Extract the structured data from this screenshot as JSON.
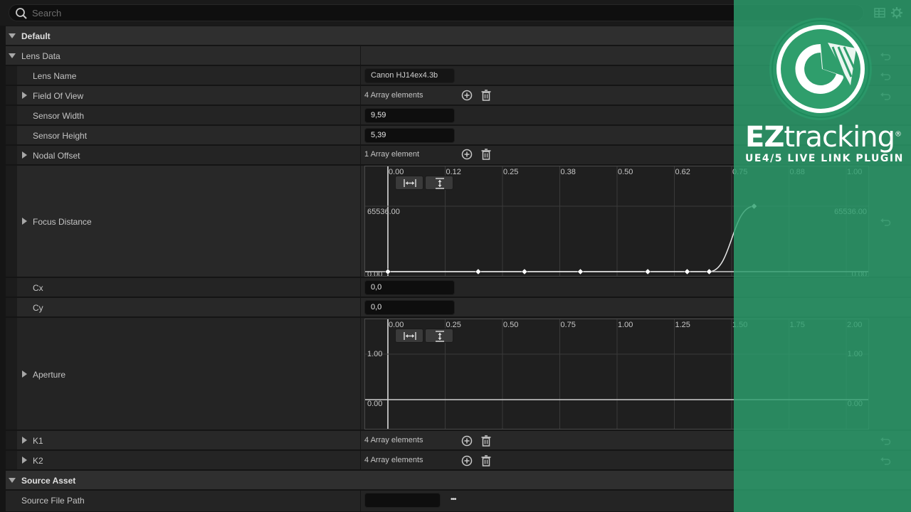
{
  "search": {
    "placeholder": "Search"
  },
  "toolbar": {
    "icons": [
      "table-view-icon",
      "settings-gear-icon"
    ]
  },
  "categories": {
    "default": "Default",
    "lens_data": "Lens Data",
    "source_asset": "Source Asset"
  },
  "properties": {
    "lens_name": {
      "label": "Lens Name",
      "value": "Canon HJ14ex4.3b"
    },
    "field_of_view": {
      "label": "Field Of View",
      "value": "4 Array elements"
    },
    "sensor_width": {
      "label": "Sensor Width",
      "value": "9,59"
    },
    "sensor_height": {
      "label": "Sensor Height",
      "value": "5,39"
    },
    "nodal_offset": {
      "label": "Nodal Offset",
      "value": "1 Array element"
    },
    "focus_distance": {
      "label": "Focus Distance"
    },
    "cx": {
      "label": "Cx",
      "value": "0,0"
    },
    "cy": {
      "label": "Cy",
      "value": "0,0"
    },
    "aperture": {
      "label": "Aperture"
    },
    "k1": {
      "label": "K1",
      "value": "4 Array elements"
    },
    "k2": {
      "label": "K2",
      "value": "4 Array elements"
    },
    "source_file_path": {
      "label": "Source File Path",
      "value": "",
      "browse": "•••"
    }
  },
  "focus_curve": {
    "x_ticks": [
      "0.00",
      "0.12",
      "0.25",
      "0.38",
      "0.50",
      "0.62",
      "0.75",
      "0.88",
      "1.00"
    ],
    "y_top_label": "65536.00",
    "y_bottom_label": "0.00",
    "keys": [
      [
        0.0,
        0
      ],
      [
        0.197,
        0
      ],
      [
        0.298,
        0
      ],
      [
        0.42,
        0
      ],
      [
        0.567,
        0
      ],
      [
        0.653,
        0
      ],
      [
        0.701,
        0
      ],
      [
        0.799,
        65536
      ]
    ]
  },
  "aperture_curve": {
    "x_ticks": [
      "0.00",
      "0.25",
      "0.50",
      "0.75",
      "1.00",
      "1.25",
      "1.50",
      "1.75",
      "2.00"
    ],
    "y_top_label": "1.00",
    "y_bottom_label": "0.00"
  },
  "branding": {
    "brand_bold": "EZ",
    "brand_rest": "tracking",
    "registered": "®",
    "tagline": "UE4/5 LIVE LINK PLUGIN",
    "overlay_color": "#2ca06e"
  }
}
